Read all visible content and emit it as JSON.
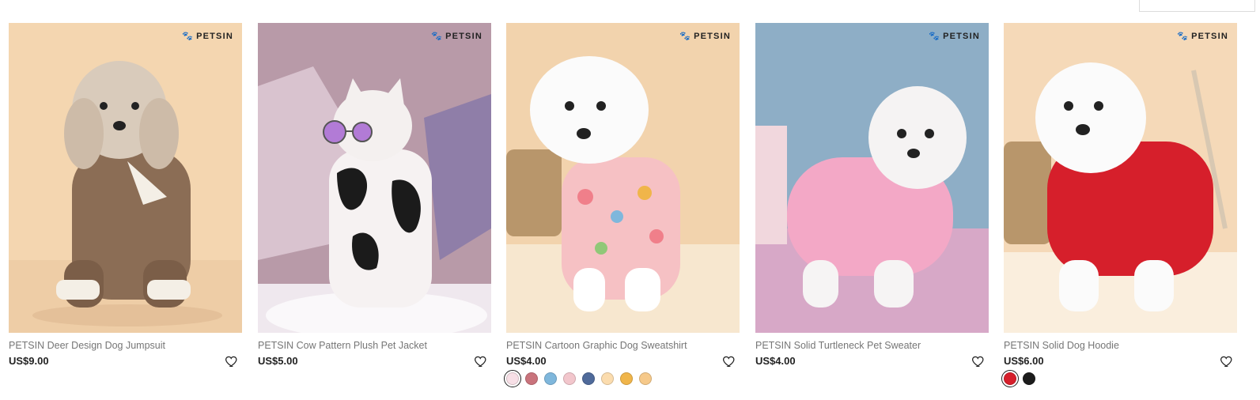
{
  "products": [
    {
      "brand": "PETSIN",
      "title": "PETSIN Deer Design Dog Jumpsuit",
      "price": "US$9.00",
      "bg": "#f4d6b0",
      "swatches": []
    },
    {
      "brand": "PETSIN",
      "title": "PETSIN Cow Pattern Plush Pet Jacket",
      "price": "US$5.00",
      "bg": "#b89aa8",
      "swatches": []
    },
    {
      "brand": "PETSIN",
      "title": "PETSIN Cartoon Graphic Dog Sweatshirt",
      "price": "US$4.00",
      "bg": "#f2d3ad",
      "swatches": [
        "#f7dfe6",
        "#c9737c",
        "#7fb7dc",
        "#f2c6cc",
        "#4f6a9a",
        "#fbdcae",
        "#f0b54a",
        "#f6c98a"
      ]
    },
    {
      "brand": "PETSIN",
      "title": "PETSIN Solid Turtleneck Pet Sweater",
      "price": "US$4.00",
      "bg": "#8eaec6",
      "swatches": []
    },
    {
      "brand": "PETSIN",
      "title": "PETSIN Solid Dog Hoodie",
      "price": "US$6.00",
      "bg": "#f5d9b8",
      "swatches": [
        "#d61f2b",
        "#1c1c1c"
      ]
    }
  ],
  "icons": {
    "wishlist": "heart-outline-icon",
    "brand_mark": "paw-icon"
  },
  "brand_paw": "🐾"
}
